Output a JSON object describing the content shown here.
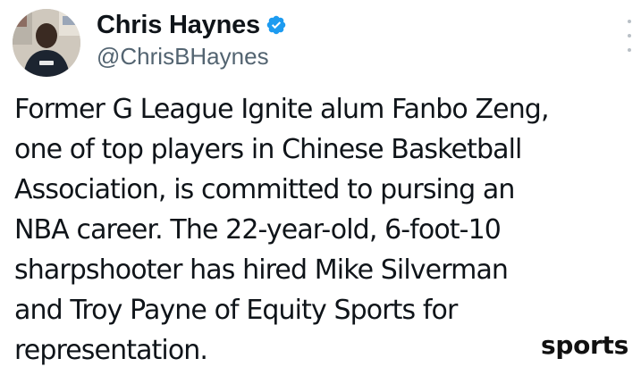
{
  "author": {
    "display_name": "Chris Haynes",
    "handle": "@ChrisBHaynes",
    "avatar_icon": "person-avatar",
    "verified_icon": "verified-badge-icon",
    "verified_color": "#1d9bf0"
  },
  "more_icon": "more-vertical-icon",
  "tweet": {
    "lines": [
      "Former G League Ignite alum Fanbo Zeng,",
      "one of top players in Chinese Basketball",
      "Association, is committed to pursing an",
      "NBA career. The 22-year-old, 6-foot-10",
      "sharpshooter has hired Mike Silverman",
      "and Troy Payne of Equity Sports for",
      "representation."
    ]
  },
  "watermark": {
    "text": "sports"
  },
  "colors": {
    "text": "#0f1419",
    "handle": "#536471",
    "background": "#ffffff"
  }
}
